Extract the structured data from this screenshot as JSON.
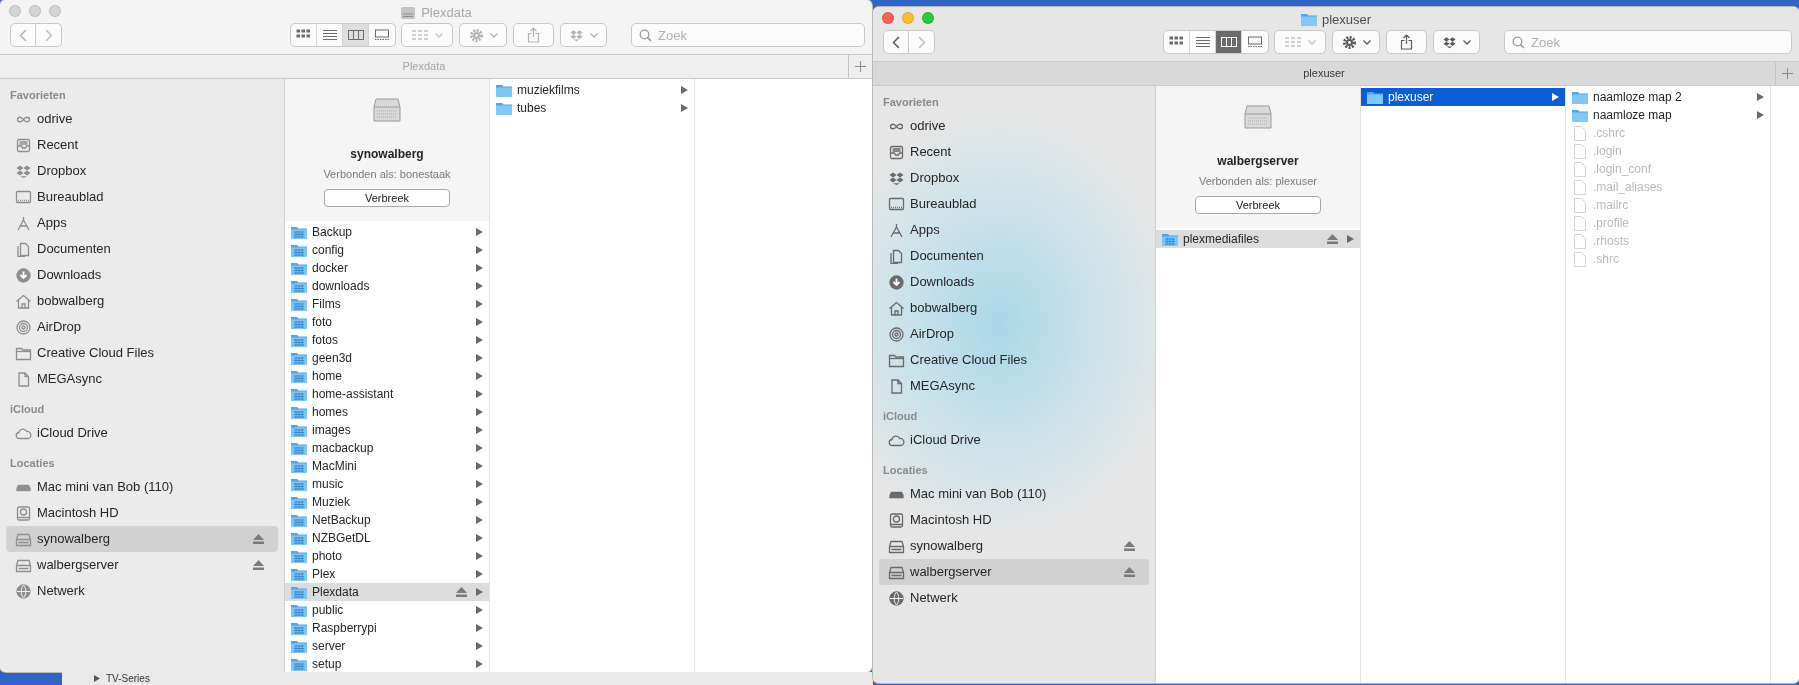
{
  "desktop": {
    "background_item": "TV-Series"
  },
  "windows": [
    {
      "active": false,
      "title_icon": {
        "kind": "server"
      },
      "title": "Plexdata",
      "view_modes": [
        {
          "kind": "icons",
          "selected": false
        },
        {
          "kind": "list",
          "selected": false
        },
        {
          "kind": "columns",
          "selected": true
        },
        {
          "kind": "gallery",
          "selected": false
        }
      ],
      "search": {
        "placeholder": "Zoek"
      },
      "path_bar": "Plexdata",
      "sidebar": [
        {
          "heading": "Favorieten",
          "items": [
            {
              "label": "odrive",
              "kind": "odrive",
              "selected": false
            },
            {
              "label": "Recent",
              "kind": "recent",
              "selected": false
            },
            {
              "label": "Dropbox",
              "kind": "dropbox",
              "selected": false
            },
            {
              "label": "Bureaublad",
              "kind": "desktop",
              "selected": false
            },
            {
              "label": "Apps",
              "kind": "apps",
              "selected": false
            },
            {
              "label": "Documenten",
              "kind": "documents",
              "selected": false
            },
            {
              "label": "Downloads",
              "kind": "downloads",
              "selected": false
            },
            {
              "label": "bobwalberg",
              "kind": "home",
              "selected": false
            },
            {
              "label": "AirDrop",
              "kind": "airdrop",
              "selected": false
            },
            {
              "label": "Creative Cloud Files",
              "kind": "folder",
              "selected": false
            },
            {
              "label": "MEGAsync",
              "kind": "file",
              "selected": false
            }
          ]
        },
        {
          "heading": "iCloud",
          "items": [
            {
              "label": "iCloud Drive",
              "kind": "cloud",
              "selected": false
            }
          ]
        },
        {
          "heading": "Locaties",
          "items": [
            {
              "label": "Mac mini van Bob (110)",
              "kind": "computer",
              "selected": false,
              "ejectable": false
            },
            {
              "label": "Macintosh HD",
              "kind": "disk",
              "selected": false,
              "ejectable": false
            },
            {
              "label": "synowalberg",
              "kind": "server",
              "selected": true,
              "ejectable": true
            },
            {
              "label": "walbergserver",
              "kind": "server",
              "selected": false,
              "ejectable": true
            },
            {
              "label": "Netwerk",
              "kind": "network",
              "selected": false,
              "ejectable": false
            }
          ]
        }
      ],
      "columns": [
        {
          "focused": false,
          "server": {
            "name": "synowalberg",
            "connected_as": "Verbonden als: bonestaak",
            "button": "Verbreek"
          },
          "items": [
            {
              "label": "Backup",
              "kind": "shared-folder",
              "selected": false,
              "ejectable": false
            },
            {
              "label": "config",
              "kind": "shared-folder",
              "selected": false,
              "ejectable": false
            },
            {
              "label": "docker",
              "kind": "shared-folder",
              "selected": false,
              "ejectable": false
            },
            {
              "label": "downloads",
              "kind": "shared-folder",
              "selected": false,
              "ejectable": false
            },
            {
              "label": "Films",
              "kind": "shared-folder",
              "selected": false,
              "ejectable": false
            },
            {
              "label": "foto",
              "kind": "shared-folder",
              "selected": false,
              "ejectable": false
            },
            {
              "label": "fotos",
              "kind": "shared-folder",
              "selected": false,
              "ejectable": false
            },
            {
              "label": "geen3d",
              "kind": "shared-folder",
              "selected": false,
              "ejectable": false
            },
            {
              "label": "home",
              "kind": "shared-folder",
              "selected": false,
              "ejectable": false
            },
            {
              "label": "home-assistant",
              "kind": "shared-folder",
              "selected": false,
              "ejectable": false
            },
            {
              "label": "homes",
              "kind": "shared-folder",
              "selected": false,
              "ejectable": false
            },
            {
              "label": "images",
              "kind": "shared-folder",
              "selected": false,
              "ejectable": false
            },
            {
              "label": "macbackup",
              "kind": "shared-folder",
              "selected": false,
              "ejectable": false
            },
            {
              "label": "MacMini",
              "kind": "shared-folder",
              "selected": false,
              "ejectable": false
            },
            {
              "label": "music",
              "kind": "shared-folder",
              "selected": false,
              "ejectable": false
            },
            {
              "label": "Muziek",
              "kind": "shared-folder",
              "selected": false,
              "ejectable": false
            },
            {
              "label": "NetBackup",
              "kind": "shared-folder",
              "selected": false,
              "ejectable": false
            },
            {
              "label": "NZBGetDL",
              "kind": "shared-folder",
              "selected": false,
              "ejectable": false
            },
            {
              "label": "photo",
              "kind": "shared-folder",
              "selected": false,
              "ejectable": false
            },
            {
              "label": "Plex",
              "kind": "shared-folder",
              "selected": false,
              "ejectable": false
            },
            {
              "label": "Plexdata",
              "kind": "shared-folder",
              "selected": true,
              "ejectable": true
            },
            {
              "label": "public",
              "kind": "shared-folder",
              "selected": false,
              "ejectable": false
            },
            {
              "label": "Raspberrypi",
              "kind": "shared-folder",
              "selected": false,
              "ejectable": false
            },
            {
              "label": "server",
              "kind": "shared-folder",
              "selected": false,
              "ejectable": false
            },
            {
              "label": "setup",
              "kind": "shared-folder",
              "selected": false,
              "ejectable": false
            }
          ]
        },
        {
          "items": [
            {
              "label": "muziekfilms",
              "kind": "folder",
              "selected": false,
              "ejectable": false
            },
            {
              "label": "tubes",
              "kind": "folder",
              "selected": false,
              "ejectable": false
            }
          ]
        }
      ]
    },
    {
      "active": true,
      "title_icon": {
        "kind": "folder"
      },
      "title": "plexuser",
      "view_modes": [
        {
          "kind": "icons",
          "selected": false
        },
        {
          "kind": "list",
          "selected": false
        },
        {
          "kind": "columns",
          "selected": true
        },
        {
          "kind": "gallery",
          "selected": false
        }
      ],
      "search": {
        "placeholder": "Zoek"
      },
      "path_bar": "plexuser",
      "sidebar": [
        {
          "heading": "Favorieten",
          "items": [
            {
              "label": "odrive",
              "kind": "odrive",
              "selected": false
            },
            {
              "label": "Recent",
              "kind": "recent",
              "selected": false
            },
            {
              "label": "Dropbox",
              "kind": "dropbox",
              "selected": false
            },
            {
              "label": "Bureaublad",
              "kind": "desktop",
              "selected": false
            },
            {
              "label": "Apps",
              "kind": "apps",
              "selected": false
            },
            {
              "label": "Documenten",
              "kind": "documents",
              "selected": false
            },
            {
              "label": "Downloads",
              "kind": "downloads",
              "selected": false
            },
            {
              "label": "bobwalberg",
              "kind": "home",
              "selected": false
            },
            {
              "label": "AirDrop",
              "kind": "airdrop",
              "selected": false
            },
            {
              "label": "Creative Cloud Files",
              "kind": "folder",
              "selected": false
            },
            {
              "label": "MEGAsync",
              "kind": "file",
              "selected": false
            }
          ]
        },
        {
          "heading": "iCloud",
          "items": [
            {
              "label": "iCloud Drive",
              "kind": "cloud",
              "selected": false
            }
          ]
        },
        {
          "heading": "Locaties",
          "items": [
            {
              "label": "Mac mini van Bob (110)",
              "kind": "computer",
              "selected": false,
              "ejectable": false
            },
            {
              "label": "Macintosh HD",
              "kind": "disk",
              "selected": false,
              "ejectable": false
            },
            {
              "label": "synowalberg",
              "kind": "server",
              "selected": false,
              "ejectable": true
            },
            {
              "label": "walbergserver",
              "kind": "server",
              "selected": true,
              "ejectable": true
            },
            {
              "label": "Netwerk",
              "kind": "network",
              "selected": false,
              "ejectable": false
            }
          ]
        }
      ],
      "columns": [
        {
          "focused": false,
          "server": {
            "name": "walbergserver",
            "connected_as": "Verbonden als: plexuser",
            "button": "Verbreek"
          },
          "items": [
            {
              "label": "plexmediafiles",
              "kind": "shared-folder",
              "selected": true,
              "ejectable": true
            }
          ]
        },
        {
          "focused": true,
          "items": [
            {
              "label": "plexuser",
              "kind": "folder",
              "selected": true,
              "ejectable": false
            }
          ]
        },
        {
          "items": [
            {
              "label": "naamloze map 2",
              "kind": "folder",
              "selected": false,
              "ejectable": false,
              "dimmed": false
            },
            {
              "label": "naamloze map",
              "kind": "folder",
              "selected": false,
              "ejectable": false,
              "dimmed": false
            },
            {
              "label": ".cshrc",
              "kind": "file",
              "selected": false,
              "ejectable": false,
              "dimmed": true
            },
            {
              "label": ".login",
              "kind": "file",
              "selected": false,
              "ejectable": false,
              "dimmed": true
            },
            {
              "label": ".login_conf",
              "kind": "file",
              "selected": false,
              "ejectable": false,
              "dimmed": true
            },
            {
              "label": ".mail_aliases",
              "kind": "file",
              "selected": false,
              "ejectable": false,
              "dimmed": true
            },
            {
              "label": ".mailrc",
              "kind": "file",
              "selected": false,
              "ejectable": false,
              "dimmed": true
            },
            {
              "label": ".profile",
              "kind": "file",
              "selected": false,
              "ejectable": false,
              "dimmed": true
            },
            {
              "label": ".rhosts",
              "kind": "file",
              "selected": false,
              "ejectable": false,
              "dimmed": true
            },
            {
              "label": ".shrc",
              "kind": "file",
              "selected": false,
              "ejectable": false,
              "dimmed": true
            }
          ]
        }
      ]
    }
  ]
}
